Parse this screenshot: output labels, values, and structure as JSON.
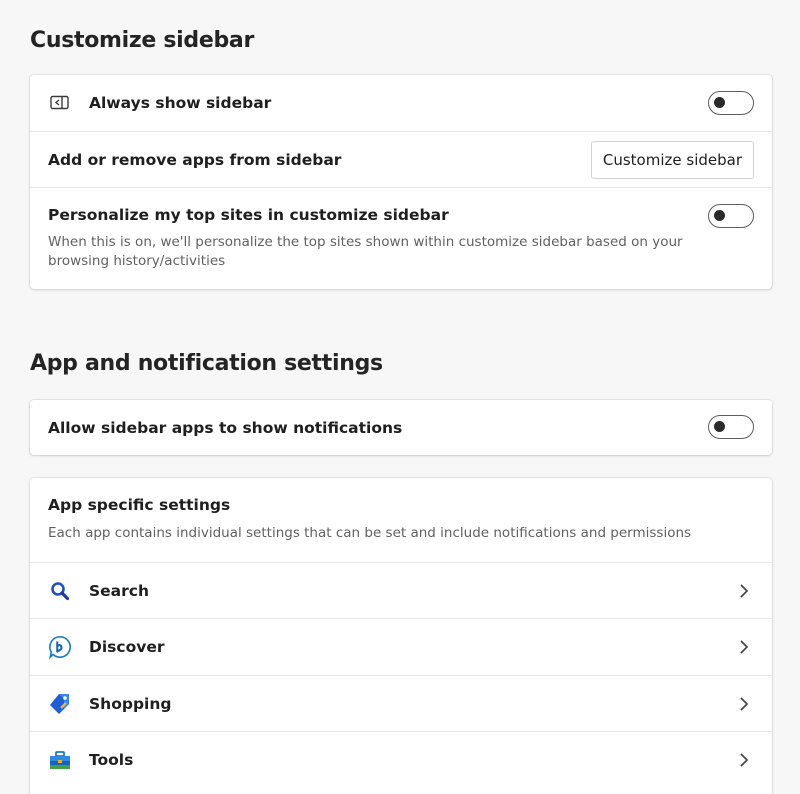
{
  "section1": {
    "title": "Customize sidebar",
    "always_show": {
      "label": "Always show sidebar",
      "icon": "sidebar-panel-icon",
      "enabled": false
    },
    "add_remove": {
      "label": "Add or remove apps from sidebar",
      "button_label": "Customize sidebar"
    },
    "personalize": {
      "label": "Personalize my top sites in customize sidebar",
      "description": "When this is on, we'll personalize the top sites shown within customize sidebar based on your browsing history/activities",
      "enabled": false
    }
  },
  "section2": {
    "title": "App and notification settings",
    "allow_notifications": {
      "label": "Allow sidebar apps to show notifications",
      "enabled": false
    },
    "app_specific": {
      "title": "App specific settings",
      "description": "Each app contains individual settings that can be set and include notifications and permissions",
      "apps": [
        {
          "label": "Search",
          "icon": "search-icon"
        },
        {
          "label": "Discover",
          "icon": "discover-icon"
        },
        {
          "label": "Shopping",
          "icon": "shopping-tag-icon"
        },
        {
          "label": "Tools",
          "icon": "toolbox-icon"
        }
      ]
    }
  },
  "colors": {
    "background": "#f7f7f7",
    "card": "#ffffff",
    "text_primary": "#1f1f1f",
    "text_secondary": "#616161"
  }
}
